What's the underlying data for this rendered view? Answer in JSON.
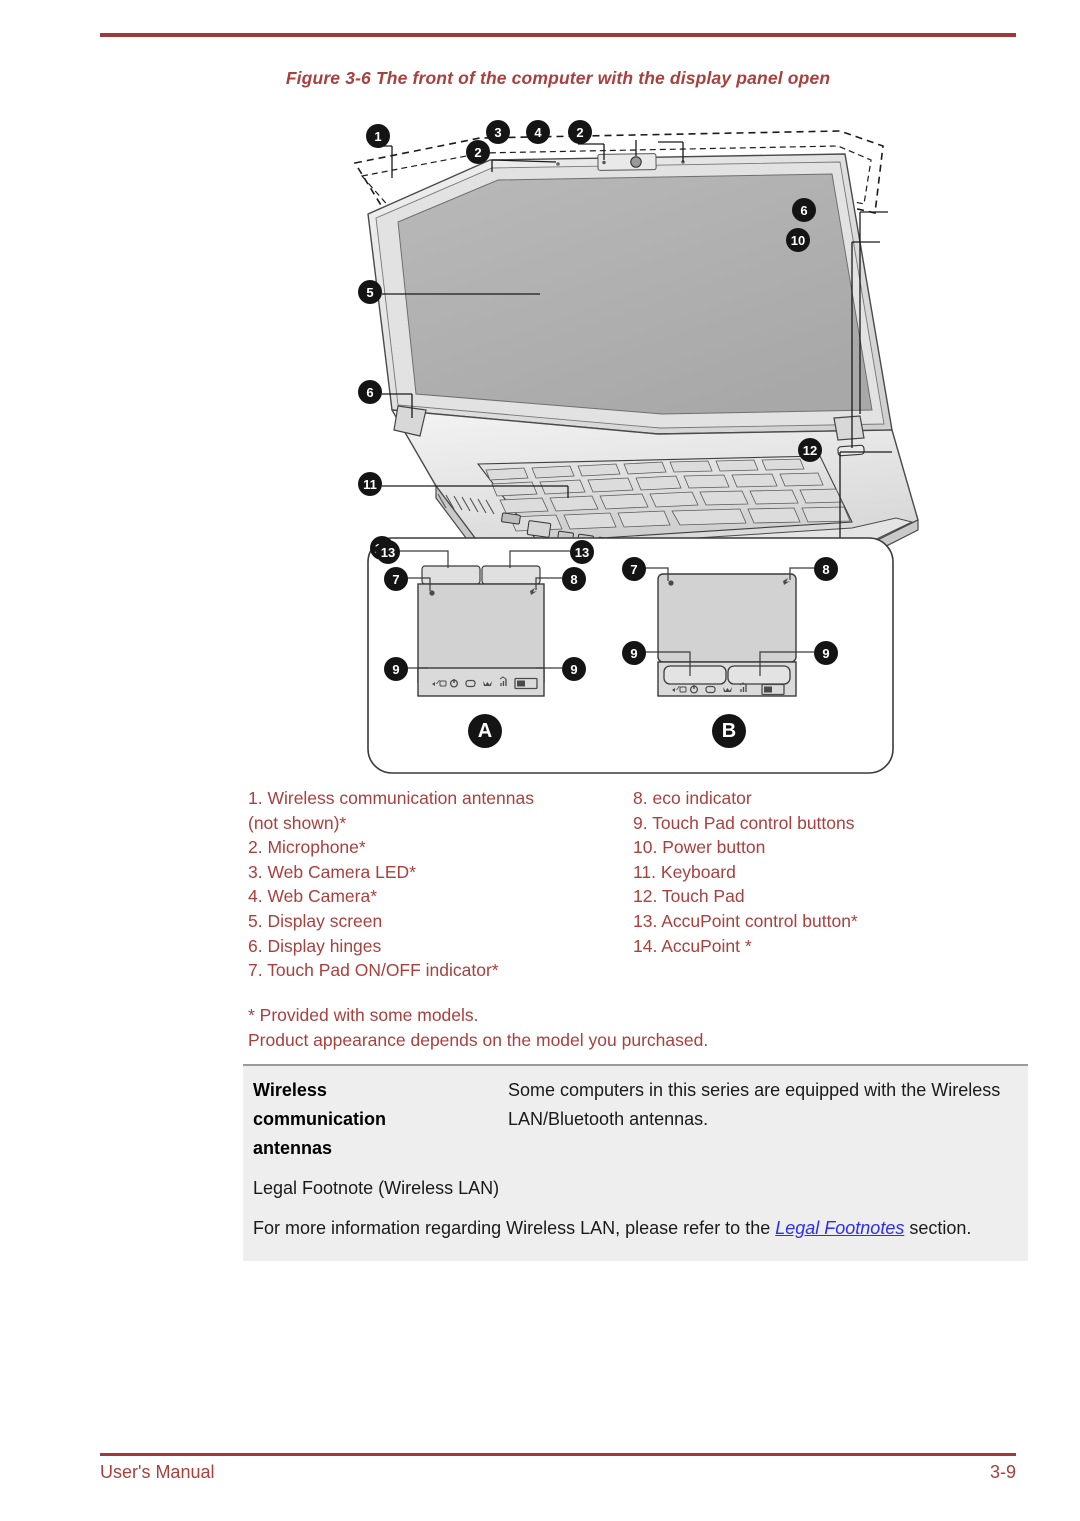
{
  "figure": {
    "caption": "Figure 3-6 The front of the computer with the display panel open",
    "callouts": [
      "1",
      "2",
      "3",
      "4",
      "5",
      "6",
      "10",
      "11",
      "12",
      "13",
      "14",
      "7",
      "8",
      "9"
    ],
    "panel_labels": [
      "A",
      "B"
    ],
    "indicator_icons": [
      "power-plug-icon",
      "power-icon",
      "hdd-icon",
      "wireless-icon",
      "signal-icon",
      "battery-icon"
    ]
  },
  "legend": {
    "left": [
      "1. Wireless communication antennas",
      "(not shown)*",
      "2. Microphone*",
      "3. Web Camera LED*",
      "4. Web Camera*",
      "5. Display screen",
      "6. Display hinges",
      "7. Touch Pad ON/OFF indicator*"
    ],
    "right": [
      "8. eco indicator",
      "",
      "9. Touch Pad control buttons",
      "10. Power button",
      "11. Keyboard",
      "12. Touch Pad",
      "13. AccuPoint control button*",
      "14. AccuPoint *"
    ],
    "notes": [
      "* Provided with some models.",
      "Product appearance depends on the model you purchased."
    ]
  },
  "spec_table": {
    "rows": [
      {
        "term": "Wireless\ncommunication\nantennas",
        "desc": "Some computers in this series are equipped with the Wireless LAN/Bluetooth antennas."
      }
    ]
  },
  "legal": {
    "title": "Legal Footnote (Wireless LAN)",
    "body_before": "For more information regarding Wireless LAN, please refer to the ",
    "link": "Legal Footnotes",
    "body_after": " section."
  },
  "footer": {
    "left": "User's Manual",
    "right": "3-9"
  },
  "colors": {
    "accent_red": "#a8403e",
    "link_blue": "#2d2df0",
    "panel_gray": "#eeeeee"
  }
}
